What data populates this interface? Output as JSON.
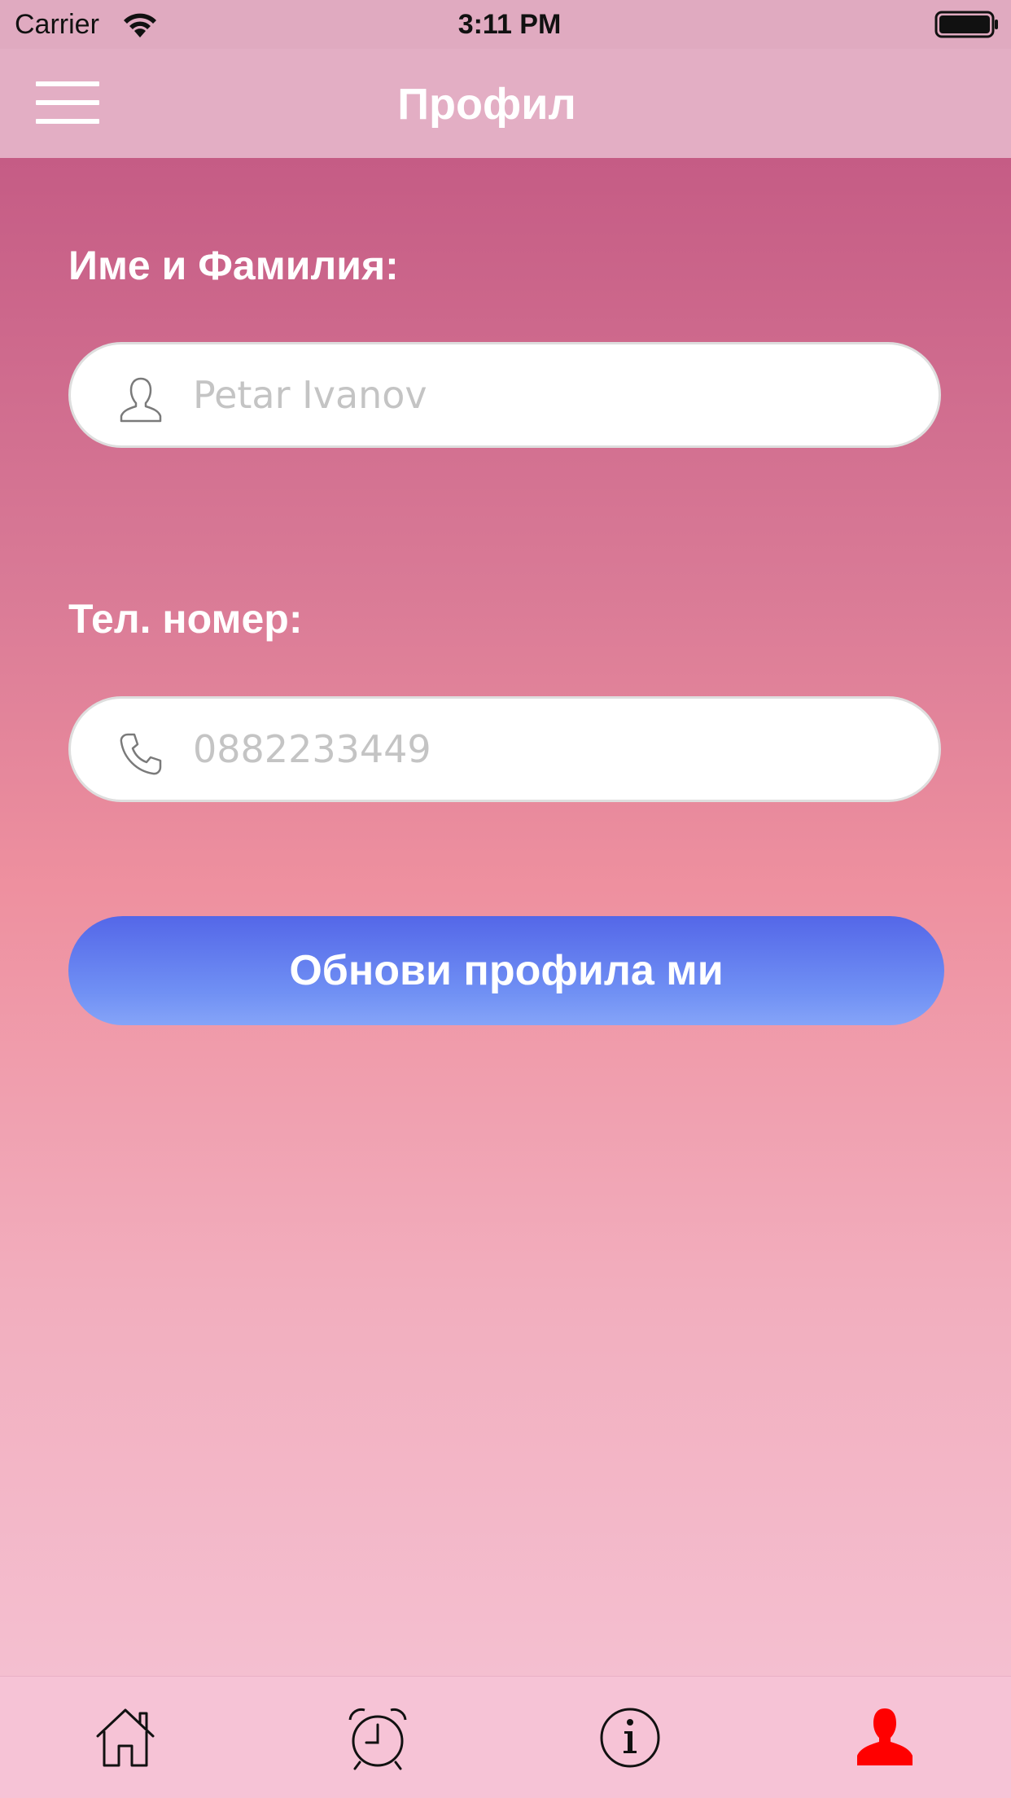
{
  "status_bar": {
    "carrier": "Carrier",
    "time": "3:11 PM",
    "wifi_icon": "wifi-icon",
    "battery_icon": "battery-icon"
  },
  "nav": {
    "title": "Профил",
    "menu_icon": "hamburger-menu-icon"
  },
  "form": {
    "name_label": "Име и Фамилия:",
    "name_placeholder": "Petar Ivanov",
    "name_icon": "user-silhouette-icon",
    "phone_label": "Тел. номер:",
    "phone_placeholder": "0882233449",
    "phone_icon": "phone-handset-icon",
    "submit_label": "Обнови профила ми"
  },
  "tabs": [
    {
      "name": "home",
      "icon": "home-icon",
      "active": false
    },
    {
      "name": "alarm",
      "icon": "alarm-clock-icon",
      "active": false
    },
    {
      "name": "info",
      "icon": "info-icon",
      "active": false
    },
    {
      "name": "profile",
      "icon": "profile-icon",
      "active": true
    }
  ],
  "colors": {
    "active_tab": "#ff0000",
    "inactive_tab": "#111111",
    "button_top": "#5467e8",
    "button_bottom": "#85a4f8",
    "gradient_top": "#c55c85",
    "gradient_bottom": "#f4bfd0"
  }
}
